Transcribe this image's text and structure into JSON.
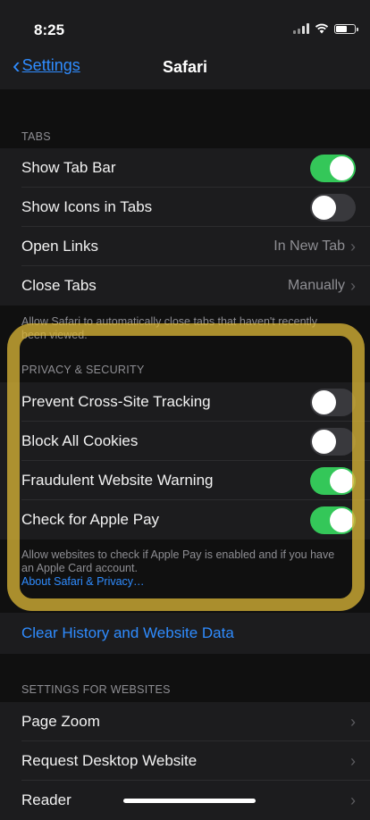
{
  "status_bar": {
    "time": "8:25"
  },
  "nav": {
    "back_label": "Settings",
    "title": "Safari"
  },
  "tabs_section": {
    "header": "TABS",
    "rows": [
      {
        "label": "Show Tab Bar",
        "toggle": true
      },
      {
        "label": "Show Icons in Tabs",
        "toggle": false
      },
      {
        "label": "Open Links",
        "value": "In New Tab"
      },
      {
        "label": "Close Tabs",
        "value": "Manually"
      }
    ],
    "footer": "Allow Safari to automatically close tabs that haven't recently been viewed."
  },
  "privacy_section": {
    "header": "PRIVACY & SECURITY",
    "rows": [
      {
        "label": "Prevent Cross-Site Tracking",
        "toggle": false
      },
      {
        "label": "Block All Cookies",
        "toggle": false
      },
      {
        "label": "Fraudulent Website Warning",
        "toggle": true
      },
      {
        "label": "Check for Apple Pay",
        "toggle": true
      }
    ],
    "footer_text": "Allow websites to check if Apple Pay is enabled and if you have an Apple Card account.",
    "footer_link": "About Safari & Privacy…"
  },
  "clear_history": "Clear History and Website Data",
  "websites_section": {
    "header": "SETTINGS FOR WEBSITES",
    "rows": [
      {
        "label": "Page Zoom"
      },
      {
        "label": "Request Desktop Website"
      },
      {
        "label": "Reader"
      }
    ]
  },
  "colors": {
    "accent": "#2f8cff",
    "toggle_on": "#34c759",
    "highlight": "#d6b236"
  }
}
